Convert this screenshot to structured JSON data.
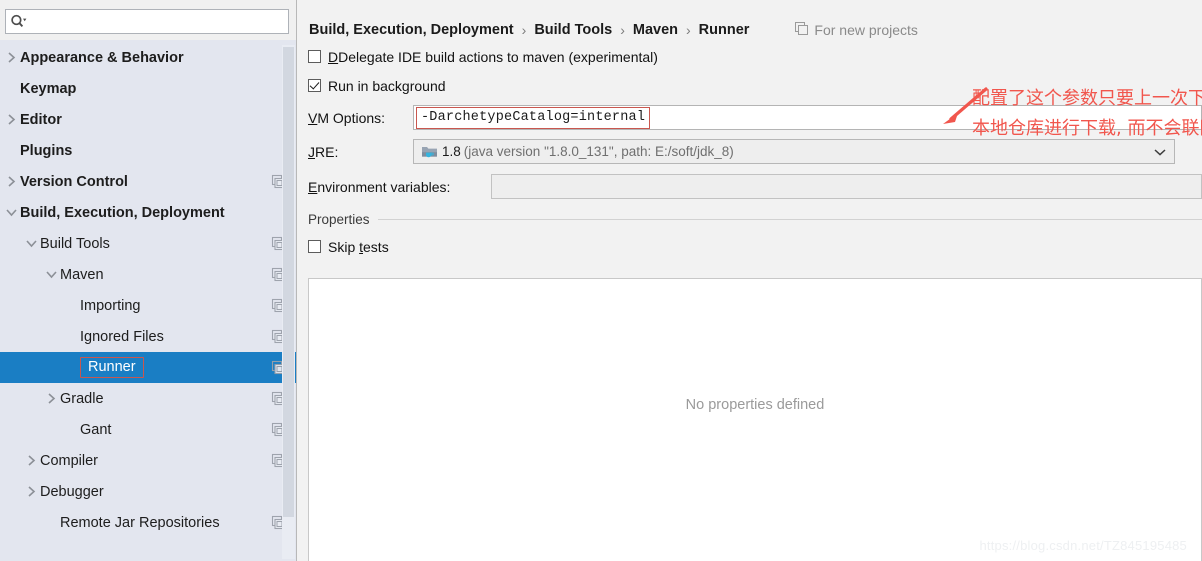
{
  "sidebar": {
    "search": {
      "value": "",
      "placeholder": "",
      "icon": "search-icon"
    },
    "items": [
      {
        "label": "Appearance & Behavior",
        "indent": 0,
        "arrow": "right",
        "bold": true,
        "badge": false,
        "selected": false
      },
      {
        "label": "Keymap",
        "indent": 0,
        "arrow": "none",
        "bold": true,
        "badge": false,
        "selected": false
      },
      {
        "label": "Editor",
        "indent": 0,
        "arrow": "right",
        "bold": true,
        "badge": false,
        "selected": false
      },
      {
        "label": "Plugins",
        "indent": 0,
        "arrow": "none",
        "bold": true,
        "badge": false,
        "selected": false
      },
      {
        "label": "Version Control",
        "indent": 0,
        "arrow": "right",
        "bold": true,
        "badge": true,
        "selected": false
      },
      {
        "label": "Build, Execution, Deployment",
        "indent": 0,
        "arrow": "down",
        "bold": true,
        "badge": false,
        "selected": false
      },
      {
        "label": "Build Tools",
        "indent": 1,
        "arrow": "down",
        "bold": false,
        "badge": true,
        "selected": false
      },
      {
        "label": "Maven",
        "indent": 2,
        "arrow": "down",
        "bold": false,
        "badge": true,
        "selected": false
      },
      {
        "label": "Importing",
        "indent": 3,
        "arrow": "none",
        "bold": false,
        "badge": true,
        "selected": false
      },
      {
        "label": "Ignored Files",
        "indent": 3,
        "arrow": "none",
        "bold": false,
        "badge": true,
        "selected": false
      },
      {
        "label": "Runner",
        "indent": 3,
        "arrow": "none",
        "bold": false,
        "badge": true,
        "selected": true
      },
      {
        "label": "Gradle",
        "indent": 2,
        "arrow": "right",
        "bold": false,
        "badge": true,
        "selected": false
      },
      {
        "label": "Gant",
        "indent": 3,
        "arrow": "none",
        "bold": false,
        "badge": true,
        "selected": false
      },
      {
        "label": "Compiler",
        "indent": 1,
        "arrow": "right",
        "bold": false,
        "badge": true,
        "selected": false
      },
      {
        "label": "Debugger",
        "indent": 1,
        "arrow": "right",
        "bold": false,
        "badge": false,
        "selected": false
      },
      {
        "label": "Remote Jar Repositories",
        "indent": 2,
        "arrow": "none",
        "bold": false,
        "badge": true,
        "selected": false
      }
    ]
  },
  "main": {
    "breadcrumb": {
      "items": [
        "Build, Execution, Deployment",
        "Build Tools",
        "Maven",
        "Runner"
      ],
      "separator": "›",
      "for_new_projects": "For new projects"
    },
    "delegate": {
      "label": "Delegate IDE build actions to maven (experimental)",
      "checked": false
    },
    "run_background": {
      "label": "Run in background",
      "checked": true
    },
    "vm_options": {
      "label": "VM Options:",
      "value": "-DarchetypeCatalog=internal"
    },
    "jre": {
      "label": "JRE:",
      "version": "1.8",
      "description": "(java version \"1.8.0_131\", path: E:/soft/jdk_8)"
    },
    "env_vars": {
      "label": "Environment variables:",
      "value": ""
    },
    "properties_section": {
      "label": "Properties"
    },
    "skip_tests": {
      "label": "Skip tests",
      "checked": false
    },
    "properties_table": {
      "empty_text": "No properties defined"
    },
    "watermark": "https://blog.csdn.net/TZ845195485"
  },
  "annotation": {
    "line1": "配置了这个参数只要上一次下载过就会在",
    "line2": "本地仓库进行下载, 而不会联网下载",
    "color": "#f1564d"
  },
  "colors": {
    "selection_blue": "#1a7ec4",
    "annotation_red": "#f1564d",
    "sidebar_bg": "#e3e6ef",
    "panel_bg": "#f2f2f2"
  }
}
